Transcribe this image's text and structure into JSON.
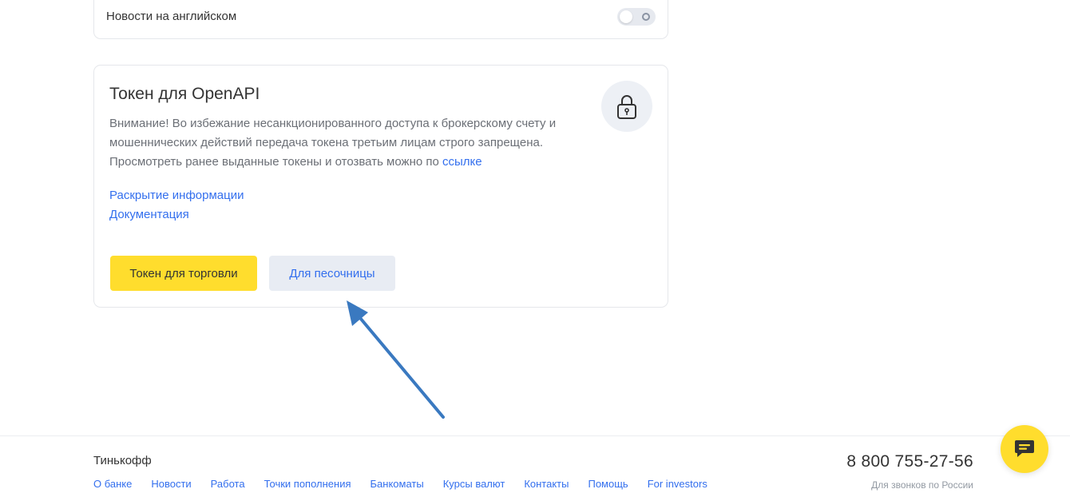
{
  "settings": {
    "english_news_label": "Новости на английском",
    "english_news_enabled": false
  },
  "token_card": {
    "title": "Токен для OpenAPI",
    "warning_line1": "Внимание! Во избежание несанкционированного доступа к брокерскому счету и",
    "warning_line2": "мошеннических действий передача токена третьим лицам строго запрещена.",
    "tokens_text": "Просмотреть ранее выданные токены и отозвать можно по ",
    "tokens_link": "ссылке",
    "disclosure_link": "Раскрытие информации",
    "docs_link": "Документация",
    "trade_token_button": "Токен для торговли",
    "sandbox_button": "Для песочницы",
    "lock_icon": "lock-icon"
  },
  "footer": {
    "brand": "Тинькофф",
    "nav": [
      "О банке",
      "Новости",
      "Работа",
      "Точки пополнения",
      "Банкоматы",
      "Курсы валют",
      "Контакты",
      "Помощь",
      "For investors"
    ],
    "phone": "8 800 755-27-56",
    "phone_note": "Для звонков по России",
    "chat_icon": "chat-icon"
  },
  "colors": {
    "accent_yellow": "#ffdd2d",
    "link_blue": "#336fee",
    "annotation_arrow": "#3a79c0"
  }
}
